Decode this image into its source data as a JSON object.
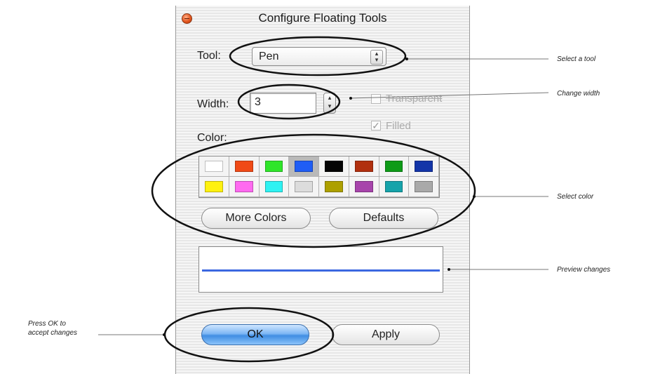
{
  "window": {
    "title": "Configure Floating Tools"
  },
  "tool": {
    "label": "Tool:",
    "value": "Pen"
  },
  "width": {
    "label": "Width:",
    "value": "3"
  },
  "options": {
    "transparent_label": "Transparent",
    "transparent_checked": false,
    "filled_label": "Filled",
    "filled_checked": true
  },
  "color": {
    "label": "Color:",
    "swatches": [
      "#ffffff",
      "#f04a16",
      "#2fe52a",
      "#1f5df5",
      "#050505",
      "#b1300f",
      "#0e9b18",
      "#1335a8",
      "#fff10f",
      "#ff6af0",
      "#2ef2f2",
      "#dcdcdc",
      "#ada000",
      "#a744ab",
      "#16a3aa",
      "#a9a9a9"
    ],
    "selected_index": 3,
    "more_colors_label": "More Colors",
    "defaults_label": "Defaults"
  },
  "preview": {
    "line_color": "#3b67e0"
  },
  "buttons": {
    "ok_label": "OK",
    "apply_label": "Apply"
  },
  "annotations": {
    "select_tool": "Select a tool",
    "change_width": "Change width",
    "select_color": "Select color",
    "preview_changes": "Preview changes",
    "press_ok_line1": "Press OK to",
    "press_ok_line2": "accept changes"
  }
}
